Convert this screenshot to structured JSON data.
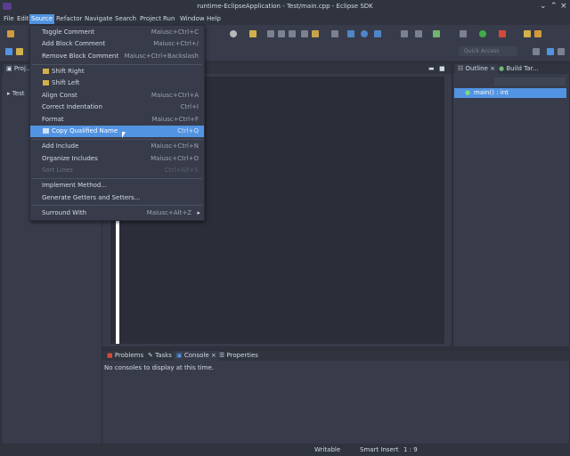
{
  "window": {
    "title": "runtime-EclipseApplication - Test/main.cpp - Eclipse SDK"
  },
  "menubar": {
    "items": [
      "File",
      "Edit",
      "Source",
      "Refactor",
      "Navigate",
      "Search",
      "Project",
      "Run",
      "Window",
      "Help"
    ],
    "active": "Source"
  },
  "toolbar": {
    "quick_access": "Quick Access"
  },
  "left_panel": {
    "tab": "Proj...",
    "tree_item": "Test"
  },
  "outline_panel": {
    "tabs": [
      "Outline",
      "Build Tar..."
    ],
    "item": "main() : int"
  },
  "bottom_panel": {
    "tabs": [
      "Problems",
      "Tasks",
      "Console",
      "Properties"
    ],
    "message": "No consoles to display at this time."
  },
  "status": {
    "writable": "Writable",
    "insert": "Smart Insert",
    "position": "1 : 9"
  },
  "source_menu": {
    "items": [
      {
        "label": "Toggle Comment",
        "shortcut": "Maiusc+Ctrl+C"
      },
      {
        "label": "Add Block Comment",
        "shortcut": "Maiusc+Ctrl+/"
      },
      {
        "label": "Remove Block Comment",
        "shortcut": "Maiusc+Ctrl+Backslash"
      },
      {
        "label": "Shift Right",
        "shortcut": ""
      },
      {
        "label": "Shift Left",
        "shortcut": ""
      },
      {
        "label": "Align Const",
        "shortcut": "Maiusc+Ctrl+A"
      },
      {
        "label": "Correct Indentation",
        "shortcut": "Ctrl+I"
      },
      {
        "label": "Format",
        "shortcut": "Maiusc+Ctrl+F"
      },
      {
        "label": "Copy Qualified Name",
        "shortcut": "Ctrl+Q"
      },
      {
        "label": "Add Include",
        "shortcut": "Maiusc+Ctrl+N"
      },
      {
        "label": "Organize Includes",
        "shortcut": "Maiusc+Ctrl+O"
      },
      {
        "label": "Sort Lines",
        "shortcut": "Ctrl+Alt+S"
      },
      {
        "label": "Implement Method...",
        "shortcut": ""
      },
      {
        "label": "Generate Getters and Setters...",
        "shortcut": ""
      },
      {
        "label": "Surround With",
        "shortcut": "Maiusc+Alt+Z"
      }
    ]
  },
  "colors": {
    "accent": "#5294e2",
    "background": "#2f343f",
    "panel": "#383c4a"
  }
}
